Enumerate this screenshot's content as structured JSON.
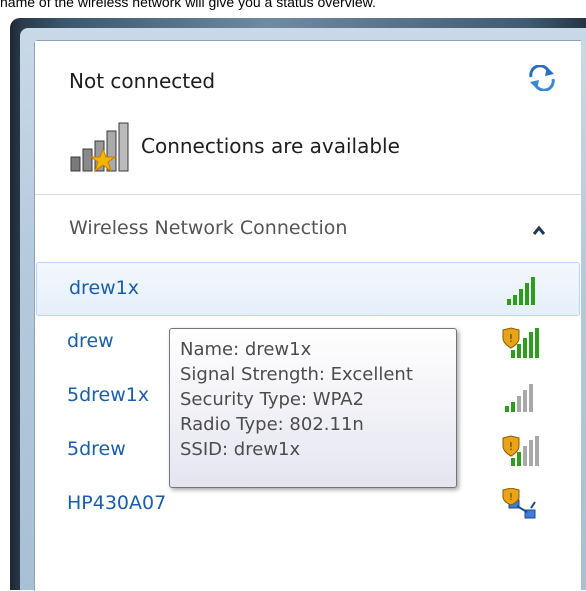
{
  "caption": "name of the wireless network will give you a status overview.",
  "header": {
    "status": "Not connected",
    "refresh_icon": "refresh-icon",
    "availability_text": "Connections are available",
    "availability_icon": "signal-star-icon"
  },
  "section": {
    "title": "Wireless Network Connection",
    "collapse_glyph": "^"
  },
  "networks": [
    {
      "name": "drew1x",
      "secured": false,
      "signal_bars": 5,
      "icon": "signal-bars-icon",
      "selected": true
    },
    {
      "name": "drew",
      "secured": true,
      "signal_bars": 5,
      "icon": "secured-signal-icon"
    },
    {
      "name": "5drew1x",
      "secured": false,
      "signal_bars": 2,
      "icon": "signal-bars-icon"
    },
    {
      "name": "5drew",
      "secured": true,
      "signal_bars": 2,
      "icon": "secured-signal-icon"
    },
    {
      "name": "HP430A07",
      "secured": true,
      "signal_bars": 0,
      "icon": "adhoc-network-icon"
    }
  ],
  "tooltip": {
    "name": "Name: drew1x",
    "signal": "Signal Strength: Excellent",
    "security": "Security Type: WPA2",
    "radio": "Radio Type: 802.11n",
    "ssid": "SSID: drew1x"
  },
  "colors": {
    "link_blue": "#1a5ea8",
    "signal_green": "#2e9c1c",
    "signal_gray": "#a8a8a8"
  }
}
